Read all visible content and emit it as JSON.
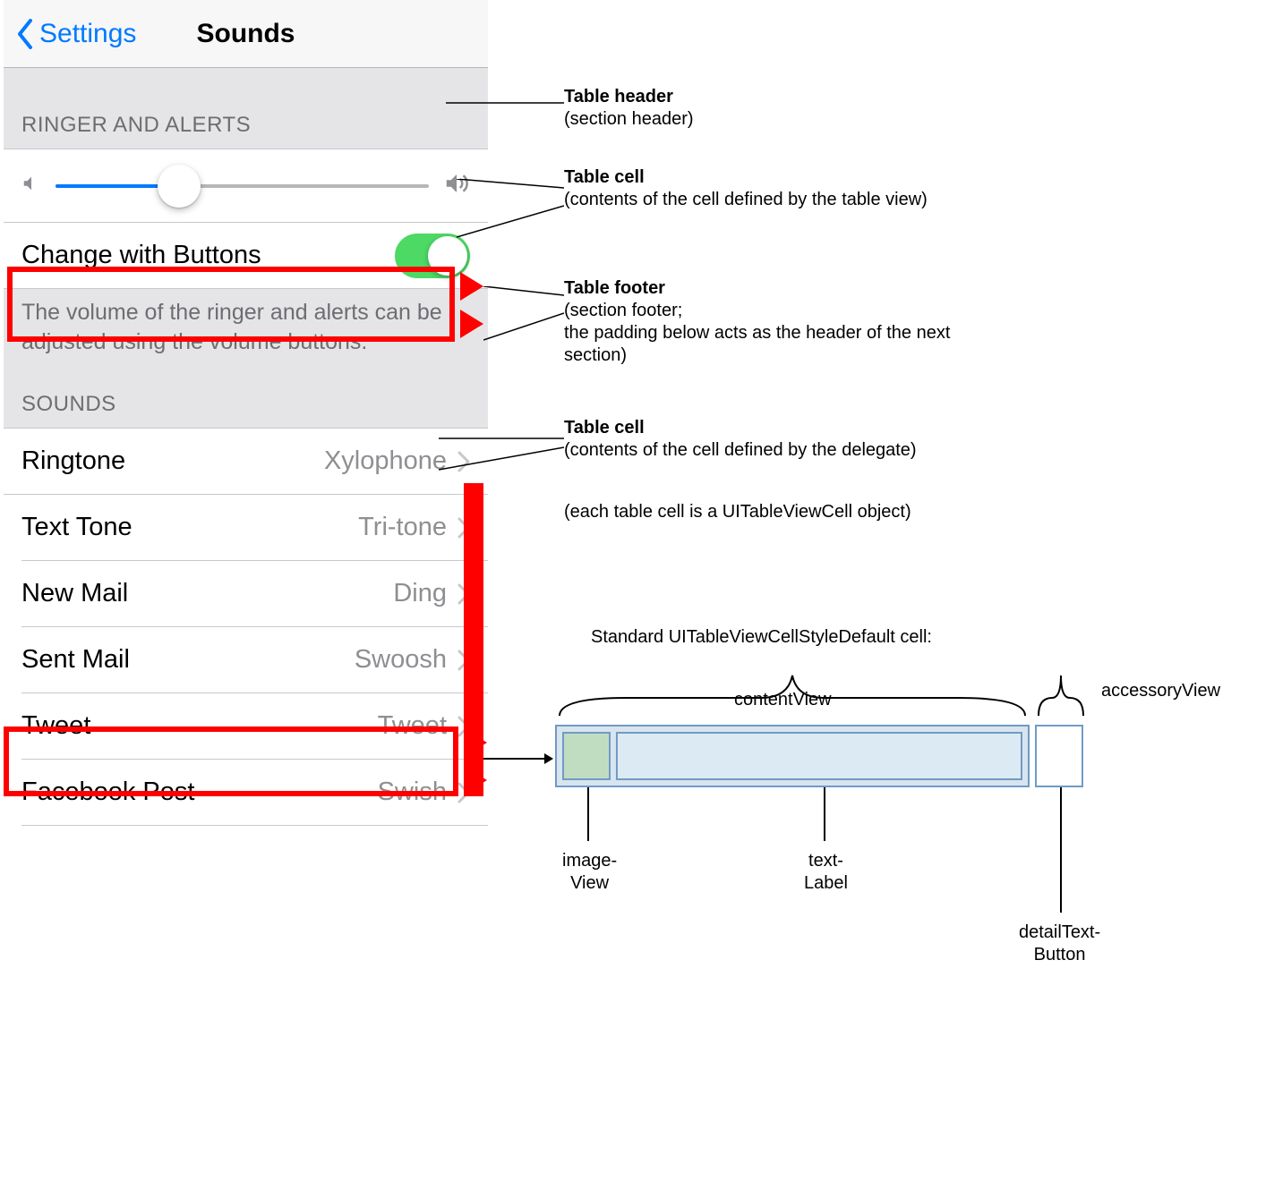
{
  "nav": {
    "back": "Settings",
    "title": "Sounds"
  },
  "section1": {
    "header": "RINGER AND ALERTS",
    "slider_percent": 33,
    "change_with_buttons": "Change with Buttons",
    "toggle_on": true,
    "footer": "The volume of the ringer and alerts can be adjusted using the volume buttons."
  },
  "section2": {
    "header": "SOUNDS",
    "rows": [
      {
        "label": "Ringtone",
        "value": "Xylophone"
      },
      {
        "label": "Text Tone",
        "value": "Tri-tone"
      },
      {
        "label": "New Mail",
        "value": "Ding"
      },
      {
        "label": "Sent Mail",
        "value": "Swoosh"
      },
      {
        "label": "Tweet",
        "value": "Tweet"
      },
      {
        "label": "Facebook Post",
        "value": "Swish"
      }
    ]
  },
  "annotations": {
    "a1_title": "Table header",
    "a1_body": "(section header)",
    "a2_title": "Table cell",
    "a2_body": "(contents of the cell defined by the table view)",
    "a3_title": "Table footer",
    "a3_body1": "(section footer;",
    "a3_body2": "the padding below acts as the header of the next section)",
    "a4_title": "Table cell",
    "a4_body": "(contents of the cell defined by the delegate)",
    "a5": "(each table cell is a UITableViewCell object)",
    "diag_caption_top": "Standard UITableViewCellStyleDefault cell:",
    "diag_cv": "contentView",
    "diag_av": "accessoryView",
    "diag_iv1": "image-",
    "diag_iv2": "View",
    "diag_tl1": "text-",
    "diag_tl2": "Label",
    "diag_dtb1": "detailText-",
    "diag_dtb2": "Button"
  }
}
